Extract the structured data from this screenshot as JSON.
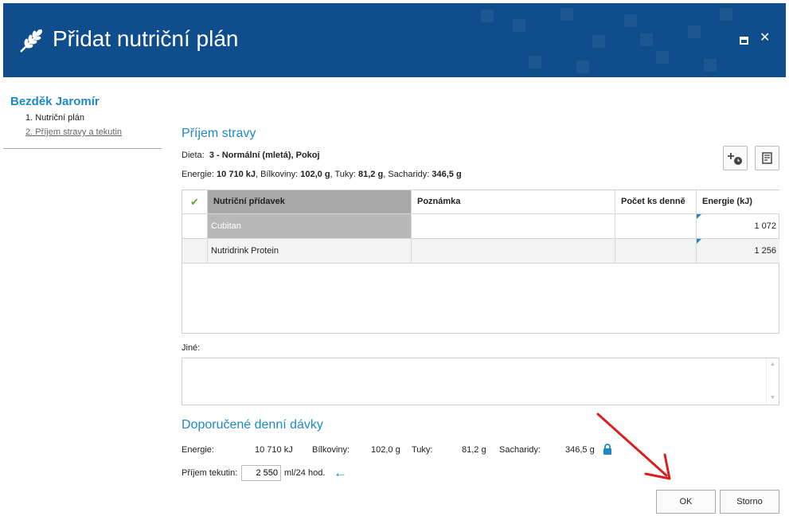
{
  "window": {
    "title": "Přidat nutriční plán"
  },
  "sidebar": {
    "patient_name": "Bezděk Jaromír",
    "items": [
      {
        "label": "1. Nutriční plán"
      },
      {
        "label": "2. Příjem stravy a tekutin"
      }
    ]
  },
  "main": {
    "section_title": "Příjem stravy",
    "diet": {
      "label": "Dieta:",
      "value": "3 - Normální (mletá), Pokoj"
    },
    "energy_summary": {
      "energy_label": "Energie:",
      "energy_value": "10 710 kJ",
      "protein_label": ", Bílkoviny:",
      "protein_value": "102,0 g",
      "fat_label": ", Tuky:",
      "fat_value": "81,2 g",
      "carb_label": ", Sacharidy:",
      "carb_value": "346,5 g"
    },
    "table": {
      "headers": [
        "Nutriční přídavek",
        "Poznámka",
        "Počet ks denně",
        "Energie (kJ)"
      ],
      "rows": [
        {
          "name": "Cubitan",
          "note": "",
          "count": "",
          "energy": "1 072"
        },
        {
          "name": "Nutridrink Protein",
          "note": "",
          "count": "",
          "energy": "1 256"
        }
      ]
    },
    "other_label": "Jiné:",
    "other_value": "",
    "recommended": {
      "title": "Doporučené denní dávky",
      "energy_label": "Energie:",
      "energy_value": "10 710 kJ",
      "protein_label": "Bílkoviny:",
      "protein_value": "102,0 g",
      "fat_label": "Tuky:",
      "fat_value": "81,2 g",
      "carb_label": "Sacharidy:",
      "carb_value": "346,5 g"
    },
    "fluid": {
      "label": "Příjem tekutin:",
      "value": "2 550",
      "unit": "ml/24 hod."
    }
  },
  "buttons": {
    "ok": "OK",
    "cancel": "Storno"
  },
  "icons": {
    "logo": "wheat-icon",
    "maximize": "maximize-icon",
    "close": "close-icon",
    "add_time": "add-schedule-icon",
    "notes": "notes-icon",
    "check": "check-icon",
    "arrow": "arrow-left-icon",
    "lock": "lock-icon"
  },
  "colors": {
    "header_bg": "#0f4d8c",
    "accent": "#1e88c8",
    "check": "#5aa832",
    "selected_header": "#a8a8a8",
    "selected_cell": "#b8b8b8",
    "annotation": "#d9201f"
  }
}
